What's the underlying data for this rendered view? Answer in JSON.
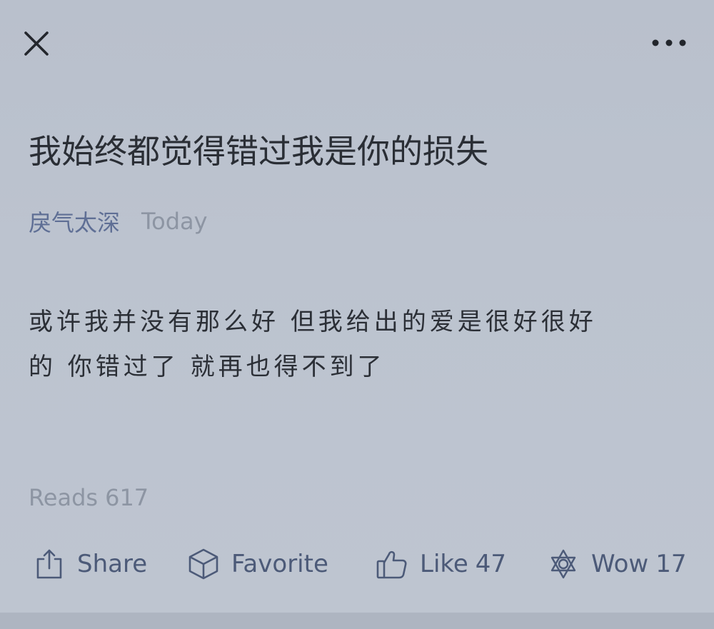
{
  "header": {
    "close_icon": "close-icon",
    "more_icon": "more-horizontal-icon"
  },
  "post": {
    "title": "我始终都觉得错过我是你的损失",
    "author": "戾气太深",
    "date": "Today",
    "body_line_1": "或许我并没有那么好 但我给出的爱是很好很好",
    "body_line_2": "的 你错过了 就再也得不到了",
    "reads_label": "Reads",
    "reads_count": "617"
  },
  "actions": {
    "share": {
      "label": "Share",
      "icon": "share-icon"
    },
    "favorite": {
      "label": "Favorite",
      "icon": "cube-icon"
    },
    "like": {
      "label": "Like",
      "count": "47",
      "icon": "thumbs-up-icon"
    },
    "wow": {
      "label": "Wow",
      "count": "17",
      "icon": "star-badge-icon"
    }
  },
  "colors": {
    "background": "#bcc3cf",
    "title_text": "#2a2e35",
    "author_link": "#5f6f95",
    "muted_text": "#8d95a3",
    "action_text": "#4c5a78"
  }
}
